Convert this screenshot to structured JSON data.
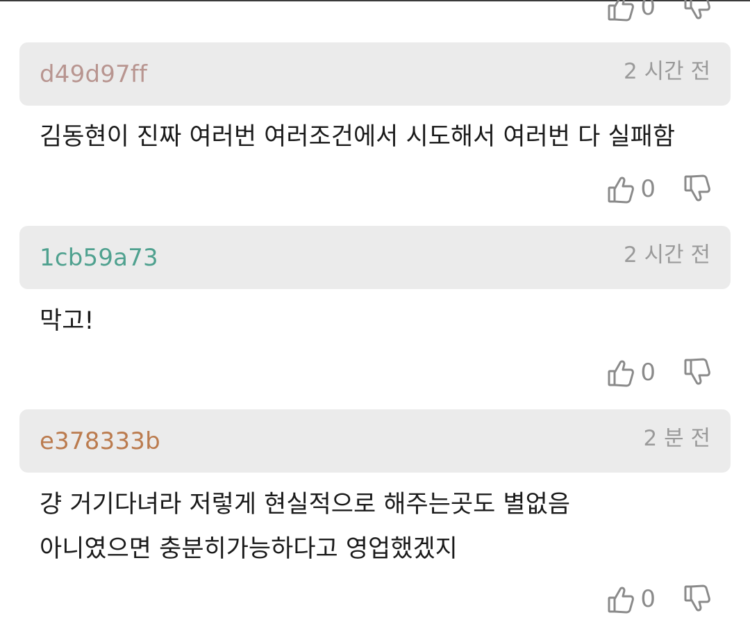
{
  "colors": {
    "author_1": "#b89590",
    "author_2": "#4fa18f",
    "author_3": "#bb7b4e",
    "icon": "#8a8a8a"
  },
  "top_partial": {
    "likes": "0"
  },
  "comments": [
    {
      "author": "d49d97ff",
      "time": "2 시간 전",
      "lines": [
        "김동현이 진짜 여러번 여러조건에서 시도해서 여러번 다 실패함"
      ],
      "likes": "0"
    },
    {
      "author": "1cb59a73",
      "time": "2 시간 전",
      "lines": [
        "막고!"
      ],
      "likes": "0"
    },
    {
      "author": "e378333b",
      "time": "2 분 전",
      "lines": [
        "걍 거기다녀라 저렇게 현실적으로 해주는곳도 별없음",
        "아니였으면 충분히가능하다고 영업했겠지"
      ],
      "likes": "0"
    }
  ],
  "icons": {
    "like": "thumbs-up-icon",
    "dislike": "thumbs-down-icon"
  }
}
